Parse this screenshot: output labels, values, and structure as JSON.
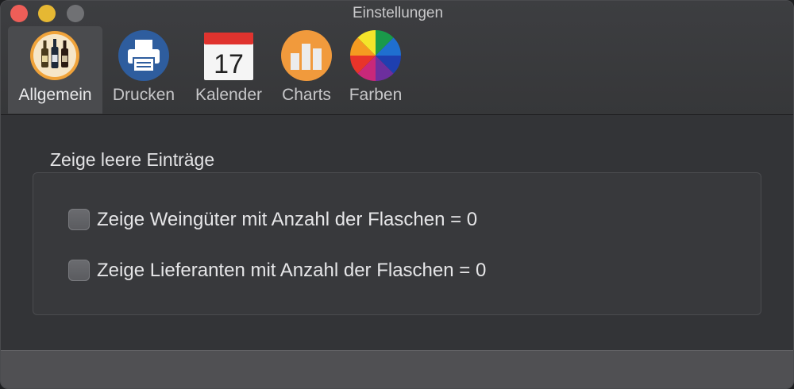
{
  "window": {
    "title": "Einstellungen"
  },
  "toolbar": {
    "items": [
      {
        "label": "Allgemein",
        "icon": "wine-bottles-icon",
        "selected": true
      },
      {
        "label": "Drucken",
        "icon": "printer-icon"
      },
      {
        "label": "Kalender",
        "icon": "calendar-icon",
        "day": "17"
      },
      {
        "label": "Charts",
        "icon": "bar-chart-icon"
      },
      {
        "label": "Farben",
        "icon": "color-wheel-icon"
      }
    ]
  },
  "group": {
    "title": "Zeige leere Einträge",
    "options": [
      {
        "label": "Zeige Weingüter mit Anzahl der Flaschen = 0",
        "checked": false
      },
      {
        "label": "Zeige Lieferanten mit Anzahl der Flaschen = 0",
        "checked": false
      }
    ]
  },
  "colors": {
    "background": "#333437",
    "selected_tab": "#4a4b4e",
    "close": "#ee5e58",
    "minimize": "#e6b833"
  }
}
